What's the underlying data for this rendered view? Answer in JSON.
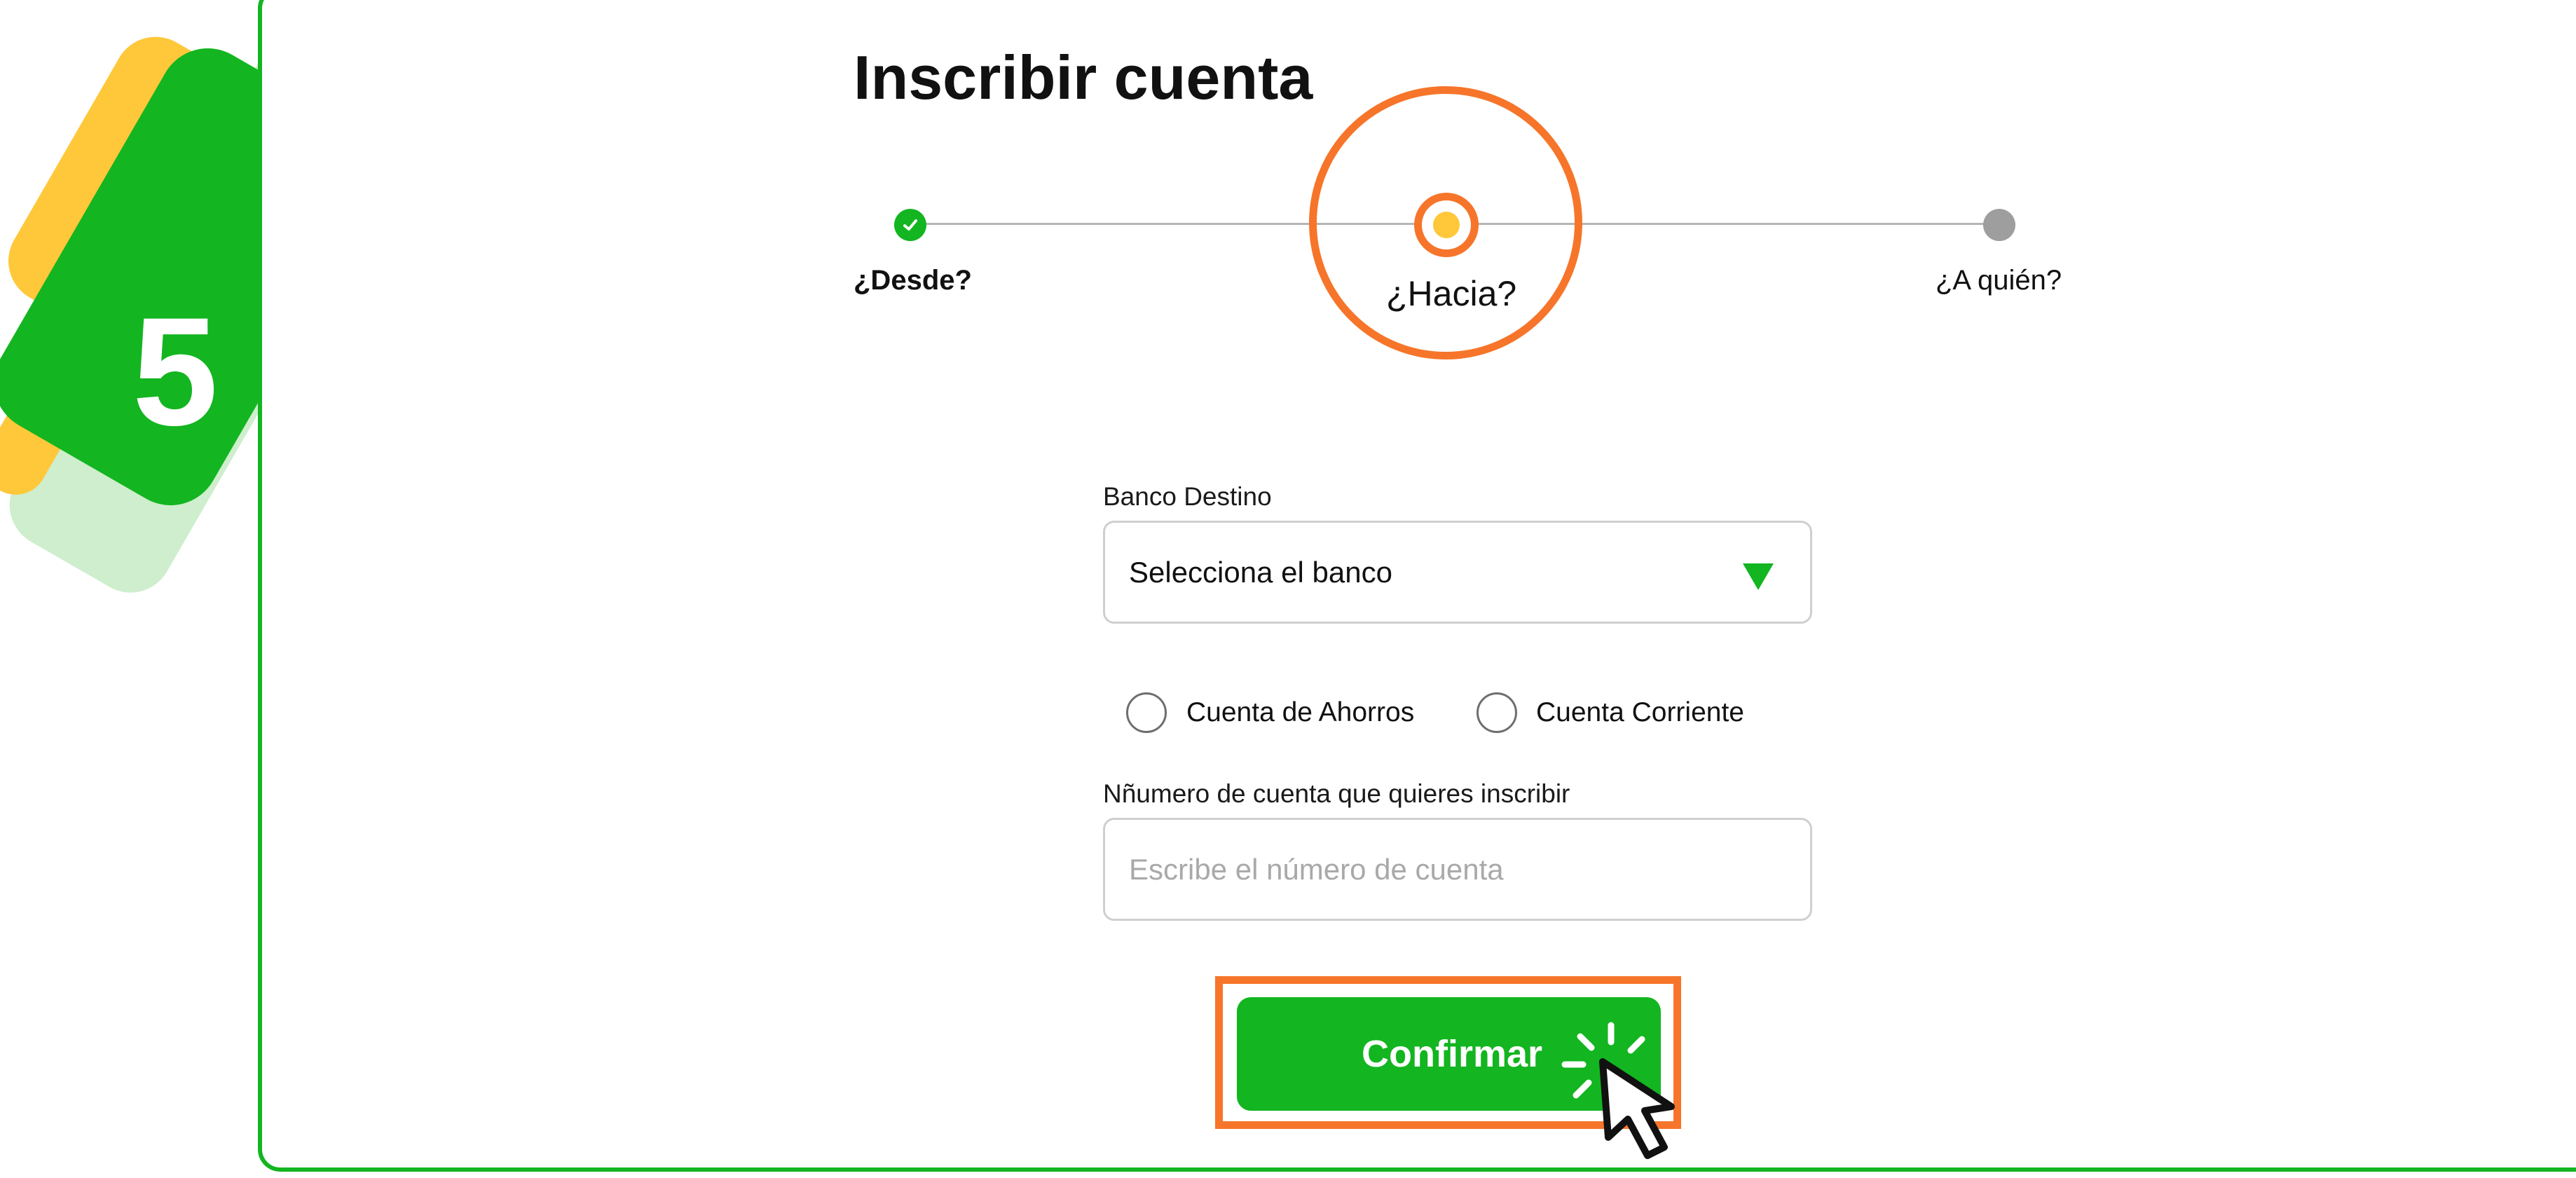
{
  "step_badge": {
    "number": "5"
  },
  "page": {
    "title": "Inscribir cuenta"
  },
  "stepper": {
    "steps": [
      {
        "label": "¿Desde?",
        "state": "done"
      },
      {
        "label": "¿Hacia?",
        "state": "current"
      },
      {
        "label": "¿A quién?",
        "state": "pending"
      }
    ]
  },
  "form": {
    "bank": {
      "label": "Banco Destino",
      "value": "Selecciona el banco"
    },
    "account_type": {
      "options": [
        {
          "label": "Cuenta de Ahorros",
          "selected": false
        },
        {
          "label": "Cuenta Corriente",
          "selected": false
        }
      ]
    },
    "account_number": {
      "label": "Nñumero de cuenta que quieres inscribir",
      "value": "",
      "placeholder": "Escribe el número de cuenta"
    },
    "confirm_label": "Confirmar"
  },
  "colors": {
    "brand_green": "#13b520",
    "highlight_orange": "#f6752a",
    "accent_yellow": "#ffc83a",
    "pending_gray": "#9e9e9e"
  },
  "icons": {
    "done_step": "check-icon",
    "select": "triangle-down-icon",
    "pointer": "mouse-cursor-icon"
  }
}
